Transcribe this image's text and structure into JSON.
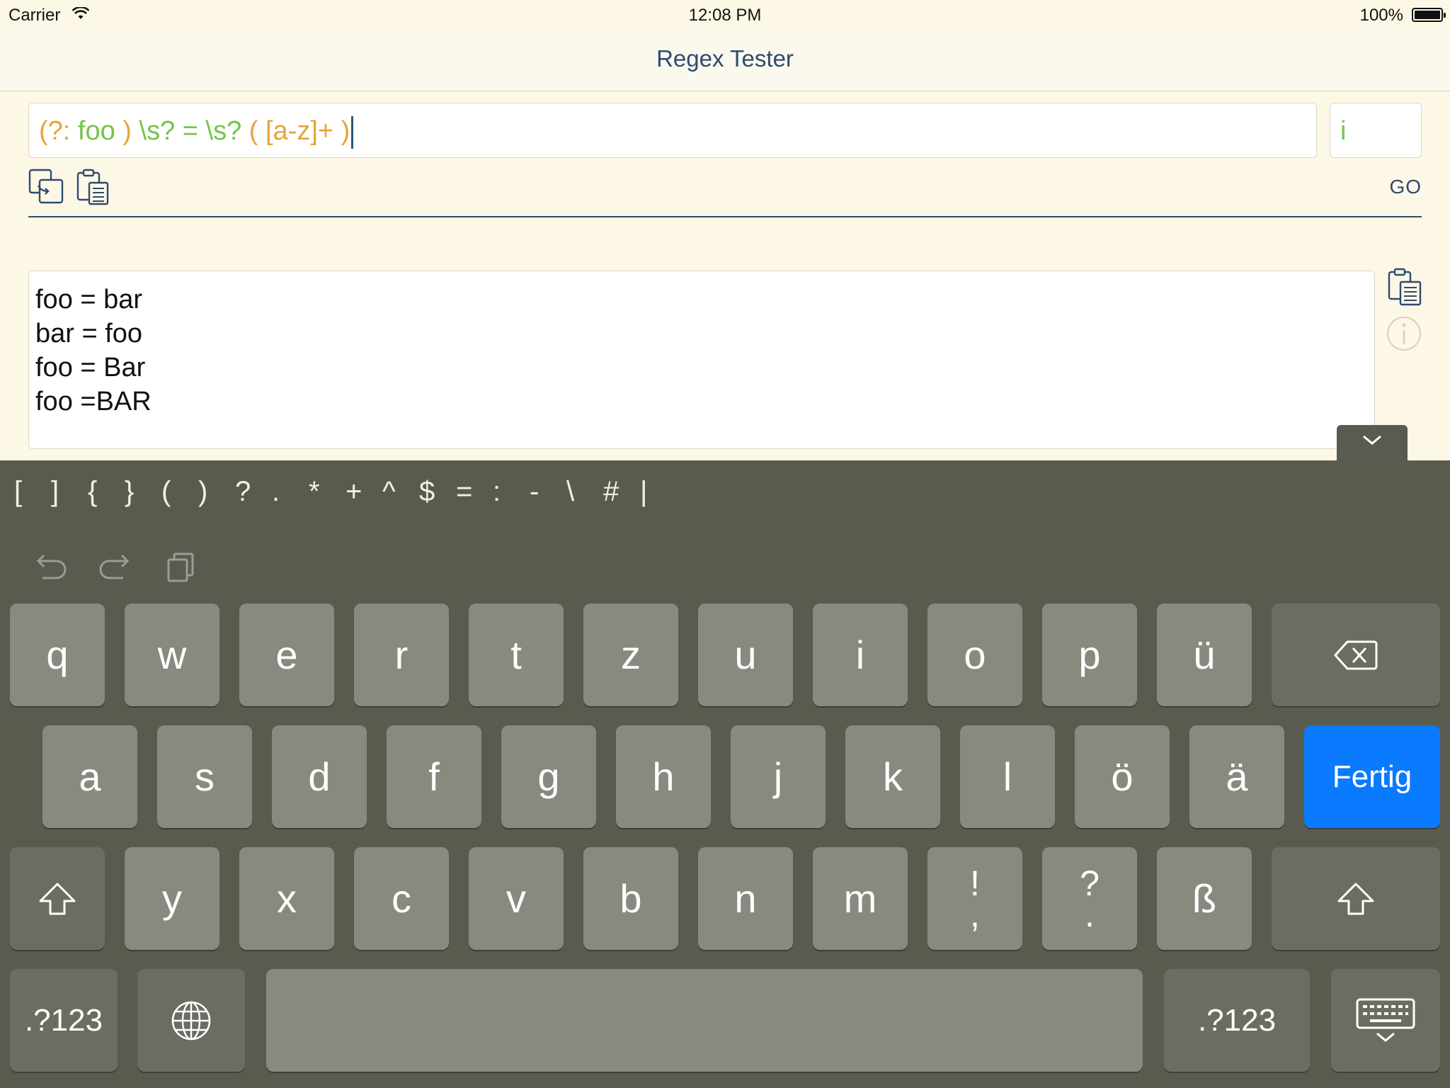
{
  "status_bar": {
    "carrier": "Carrier",
    "time": "12:08 PM",
    "battery_percent": "100%"
  },
  "nav": {
    "title": "Regex Tester"
  },
  "regex": {
    "tokens": [
      {
        "text": "(?: ",
        "color": "orange"
      },
      {
        "text": "foo ",
        "color": "green"
      },
      {
        "text": ") ",
        "color": "orange"
      },
      {
        "text": "\\s? = \\s? ",
        "color": "green"
      },
      {
        "text": "( ",
        "color": "orange"
      },
      {
        "text": "[a-z]+",
        "color": "orange"
      },
      {
        "text": " )",
        "color": "orange"
      }
    ],
    "flags": "i"
  },
  "actions": {
    "go_label": "GO"
  },
  "test_text": {
    "lines": [
      "foo = bar",
      "bar = foo",
      "foo = Bar",
      "foo =BAR"
    ]
  },
  "symbol_bar": [
    "[",
    "]",
    "{",
    "}",
    "(",
    ")",
    "?",
    ".",
    "*",
    "+",
    "^",
    "$",
    "=",
    ":",
    "-",
    "\\",
    "#",
    "|"
  ],
  "keyboard": {
    "row1": [
      "q",
      "w",
      "e",
      "r",
      "t",
      "z",
      "u",
      "i",
      "o",
      "p",
      "ü"
    ],
    "row2": [
      "a",
      "s",
      "d",
      "f",
      "g",
      "h",
      "j",
      "k",
      "l",
      "ö",
      "ä"
    ],
    "done_label": "Fertig",
    "row3": [
      "y",
      "x",
      "c",
      "v",
      "b",
      "n",
      "m"
    ],
    "row3_punct": [
      {
        "top": "!",
        "bottom": ","
      },
      {
        "top": "?",
        "bottom": "."
      }
    ],
    "eszett": "ß",
    "numbers_label": ".?123"
  },
  "colors": {
    "accent_blue": "#0a7aff",
    "nav_title": "#2f4b6e",
    "regex_green": "#76c44a",
    "regex_orange": "#e8a43b",
    "background": "#fdf8e6",
    "keyboard_bg": "#5a5b4f"
  },
  "icons": [
    "wifi-icon",
    "battery-icon",
    "copy-regex-icon",
    "paste-icon",
    "info-icon",
    "chevron-down-icon",
    "undo-icon",
    "redo-icon",
    "clipboard-icon",
    "backspace-icon",
    "shift-icon",
    "globe-icon",
    "hide-keyboard-icon"
  ]
}
